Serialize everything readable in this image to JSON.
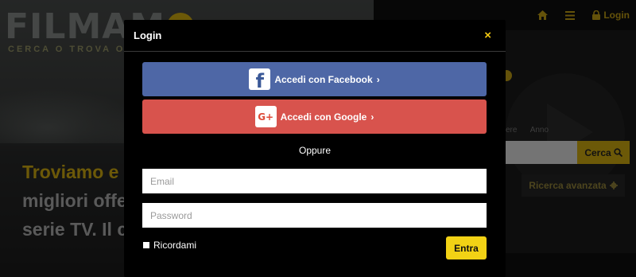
{
  "background": {
    "logo_text": "FILMAM",
    "tagline": "CERCA O TROVA O GUARDA",
    "hero_accent": "Troviamo e",
    "hero_line2": "migliori offe",
    "hero_line3": "serie TV. Il ci",
    "nav_login_label": "Login",
    "filter_genre": "ere",
    "filter_year": "Anno",
    "search_button_label": "Cerca",
    "advanced_search_label": "Ricerca avanzata"
  },
  "modal": {
    "title": "Login",
    "close_symbol": "×",
    "facebook_label": "Accedi con Facebook",
    "google_label": "Accedi con Google",
    "chevron": "›",
    "divider_text": "Oppure",
    "email_placeholder": "Email",
    "password_placeholder": "Password",
    "remember_label": "Ricordami",
    "submit_label": "Entra"
  },
  "icons": {
    "facebook": "f",
    "google": "G+",
    "home": "home-icon",
    "menu": "menu-icon",
    "lock": "lock-icon",
    "search": "search-icon",
    "gear": "gear-icon"
  },
  "colors": {
    "accent": "#f2d215",
    "facebook": "#4e67a6",
    "google": "#d8534d"
  }
}
